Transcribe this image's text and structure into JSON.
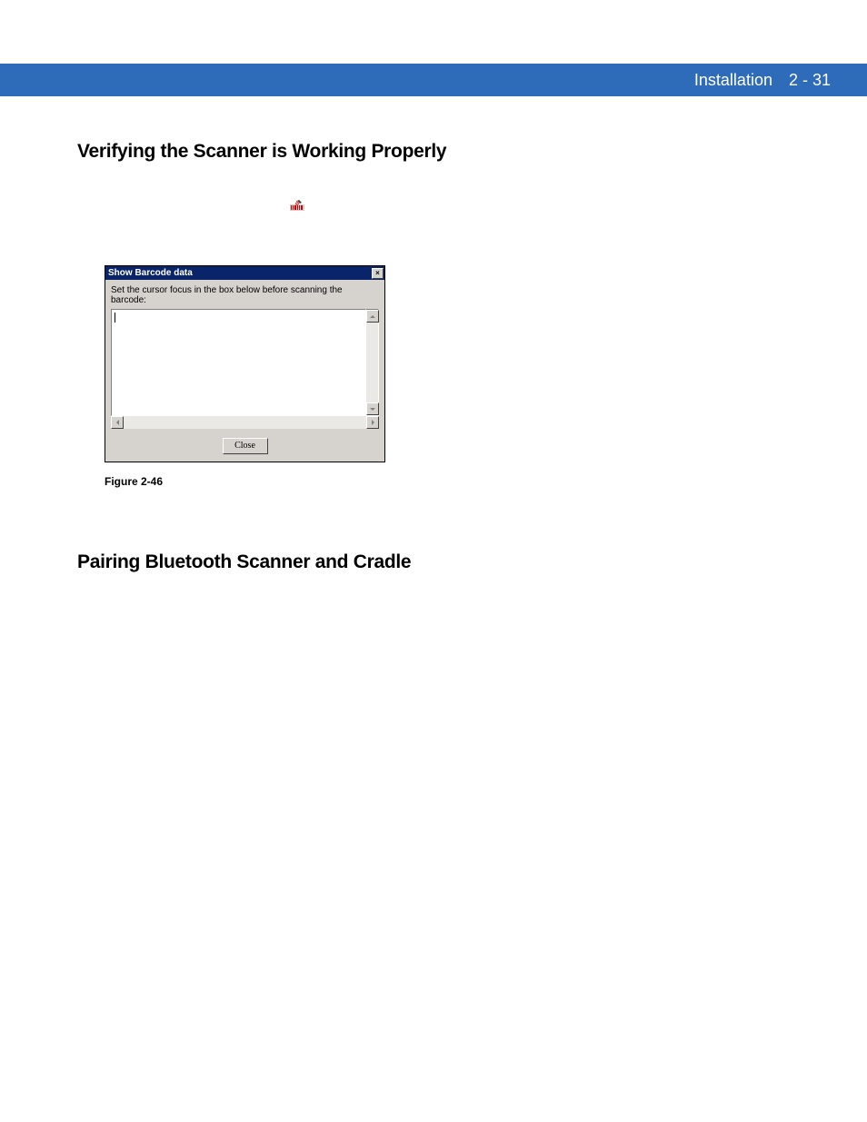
{
  "header": {
    "title": "Installation",
    "page": "2 - 31"
  },
  "section1": {
    "heading": "Verifying the Scanner is Working Properly"
  },
  "dialog": {
    "title": "Show Barcode data",
    "instruction": "Set the cursor focus in the box below before scanning the barcode:",
    "close_button": "Close",
    "close_x": "×"
  },
  "figure": {
    "caption": "Figure 2-46"
  },
  "section2": {
    "heading": "Pairing Bluetooth Scanner and Cradle"
  }
}
